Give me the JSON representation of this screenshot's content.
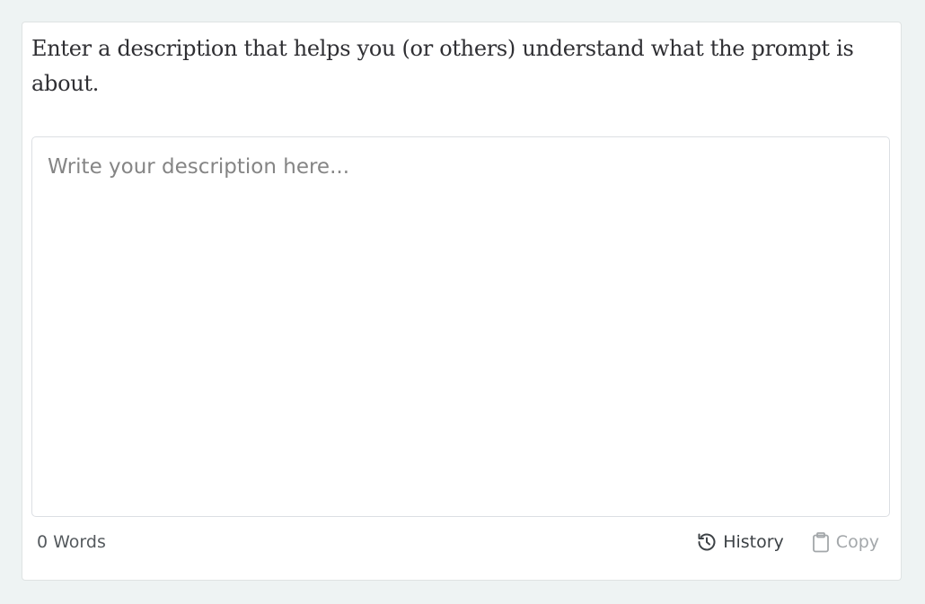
{
  "description_panel": {
    "instructions": "Enter a description that helps you (or others) understand what the prompt is about.",
    "editor": {
      "value": "",
      "placeholder": "Write your description here..."
    },
    "footer": {
      "word_count": "0 Words",
      "history_label": "History",
      "history_icon": "history-icon",
      "copy_label": "Copy",
      "copy_icon": "clipboard-icon"
    }
  },
  "colors": {
    "page_background": "#eef3f3",
    "card_background": "#ffffff",
    "border": "#dcdfe3",
    "text_primary": "#2f2f33",
    "placeholder": "#858585",
    "disabled": "#a3a7aa"
  }
}
